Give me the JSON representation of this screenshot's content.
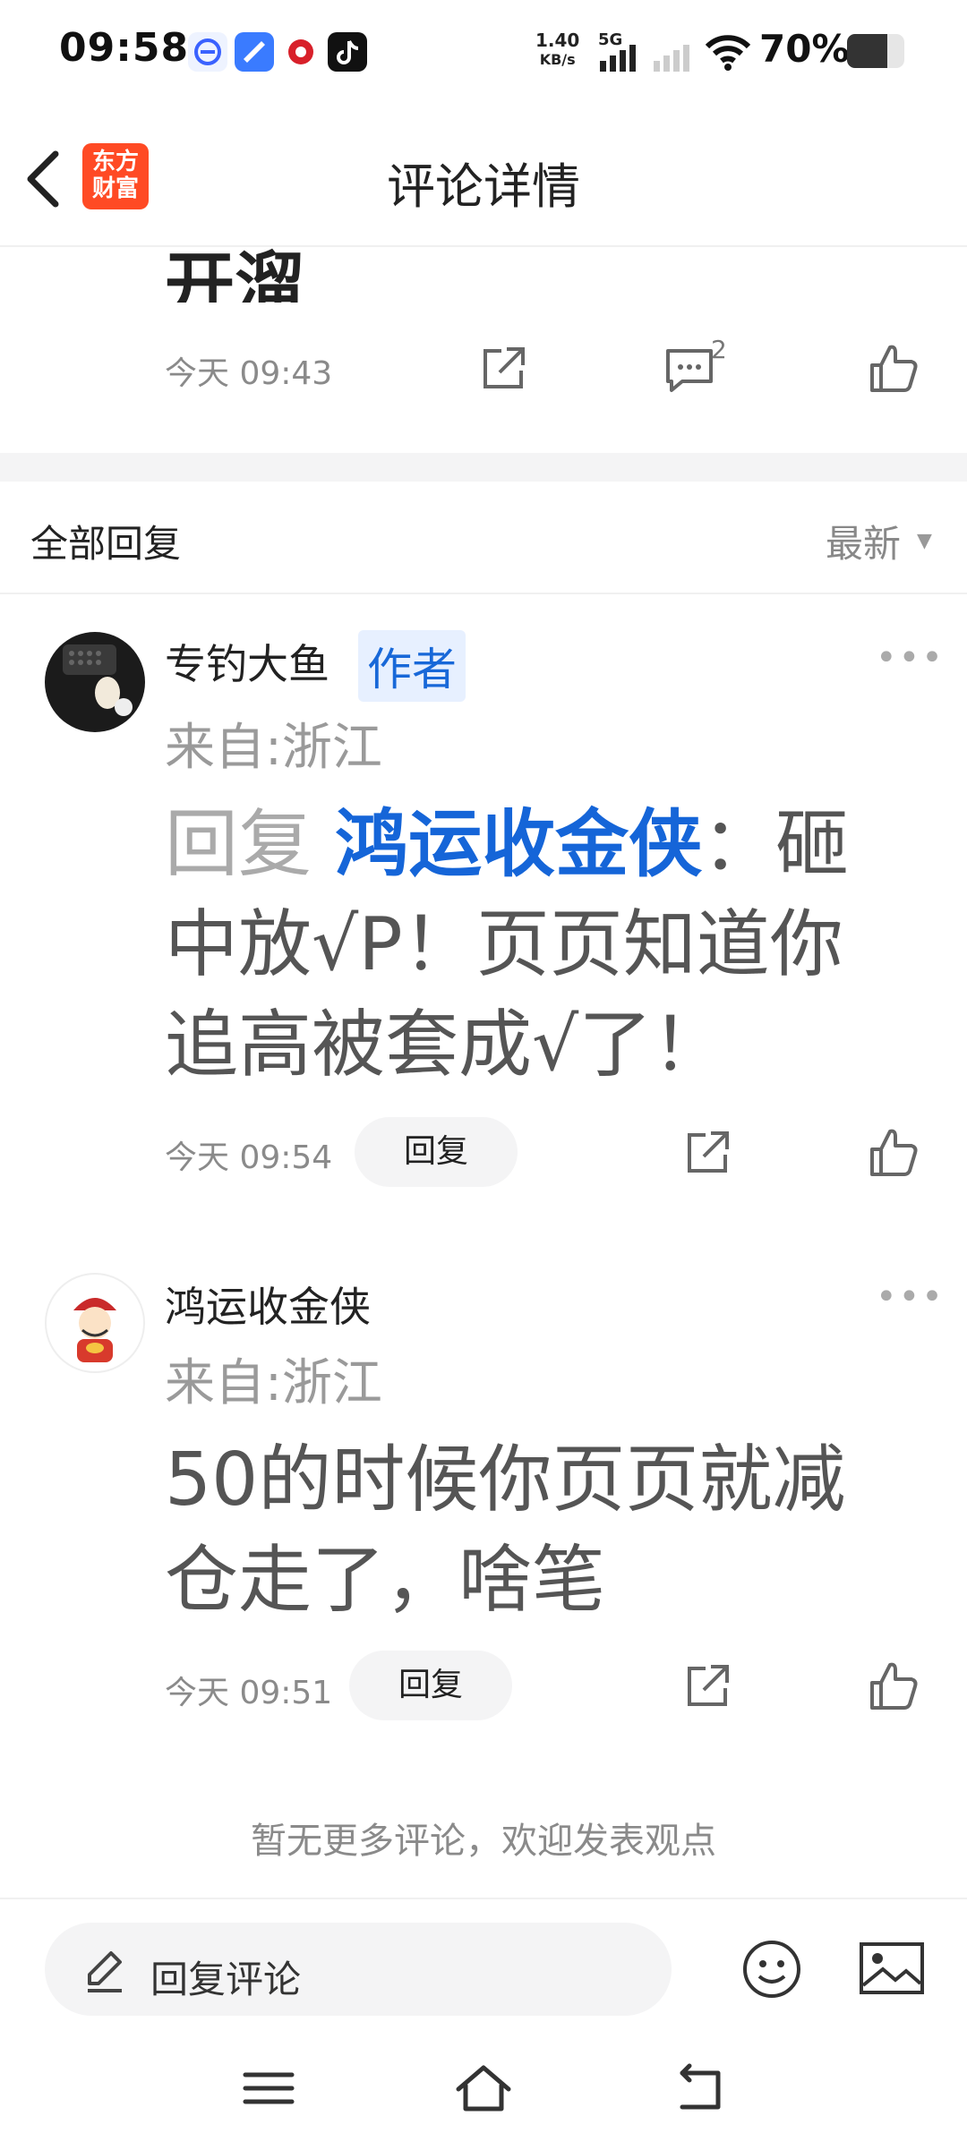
{
  "status_bar": {
    "time": "09:58",
    "net_speed_value": "1.40",
    "net_speed_unit": "KB/s",
    "network_type": "5G",
    "battery": "70%",
    "battery_level": 0.7
  },
  "header": {
    "title": "评论详情",
    "logo_line1": "东方",
    "logo_line2": "财富"
  },
  "post": {
    "text_tail": "开溜",
    "time": "今天 09:43",
    "comment_count": "2"
  },
  "replies_section": {
    "title": "全部回复",
    "sort": "最新"
  },
  "comments": [
    {
      "username": "专钓大鱼",
      "tag": "作者",
      "location": "来自:浙江",
      "reply_prefix": "回复 ",
      "mention": "鸿运收金侠",
      "text_line1_rest": "：砸",
      "text_line2": "中放√P！页页知道你",
      "text_line3": "追高被套成√了！",
      "time": "今天 09:54",
      "reply_label": "回复"
    },
    {
      "username": "鸿运收金侠",
      "location": "来自:浙江",
      "text_line1": "50的时候你页页就减",
      "text_line2": "仓走了，啥笔",
      "time": "今天 09:51",
      "reply_label": "回复"
    }
  ],
  "footer_note": "暂无更多评论，欢迎发表观点",
  "bottom_bar": {
    "input_label": "回复评论"
  },
  "colors": {
    "accent_blue": "#1565d8",
    "brand_orange": "#ff4a24"
  }
}
